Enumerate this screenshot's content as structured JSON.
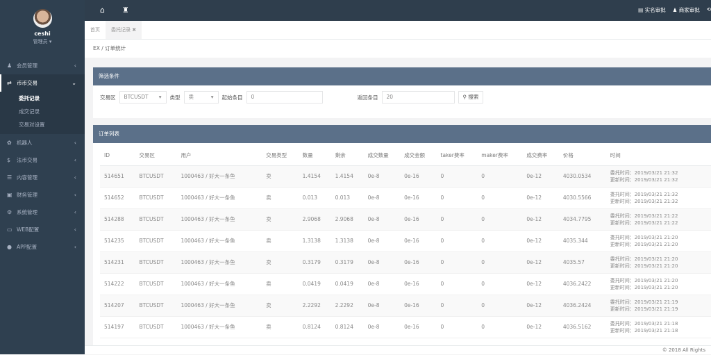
{
  "user": {
    "name": "ceshi",
    "role": "管理员 ▾"
  },
  "sidebar": {
    "items": [
      {
        "icon": "user-icon",
        "glyph": "♟",
        "label": "会员管理"
      },
      {
        "icon": "exchange-icon",
        "glyph": "⇄",
        "label": "币币交易",
        "expanded": true,
        "children": [
          {
            "label": "委托记录",
            "active": true
          },
          {
            "label": "成交记录"
          },
          {
            "label": "交易对设置"
          }
        ]
      },
      {
        "icon": "robot-icon",
        "glyph": "✿",
        "label": "机器人"
      },
      {
        "icon": "dollar-icon",
        "glyph": "$",
        "label": "法币交易"
      },
      {
        "icon": "list-icon",
        "glyph": "☰",
        "label": "内容管理"
      },
      {
        "icon": "money-icon",
        "glyph": "▣",
        "label": "财务管理"
      },
      {
        "icon": "gears-icon",
        "glyph": "⚙",
        "label": "系统管理"
      },
      {
        "icon": "laptop-icon",
        "glyph": "▭",
        "label": "WEB配置"
      },
      {
        "icon": "app-icon",
        "glyph": "●",
        "label": "APP配置"
      }
    ]
  },
  "topbar": {
    "right": [
      {
        "icon": "id-card-icon",
        "glyph": "▤",
        "label": "实名审批"
      },
      {
        "icon": "user-icon",
        "glyph": "♟",
        "label": "商家审批"
      },
      {
        "icon": "refresh-icon",
        "glyph": "⟲",
        "label": ""
      }
    ]
  },
  "tabs": [
    {
      "label": "首页"
    },
    {
      "label": "委托记录 ✖",
      "active": true
    }
  ],
  "breadcrumb": "EX / 订单统计",
  "filter": {
    "title": "筛选条件",
    "market_label": "交易区",
    "market": "BTCUSDT",
    "type_label": "类型",
    "type": "卖",
    "start_label": "起始条目",
    "start": "0",
    "count_label": "返回条目",
    "count": "20",
    "search": "搜索"
  },
  "table": {
    "title": "订单列表",
    "headers": [
      "ID",
      "交易区",
      "用户",
      "交易类型",
      "数量",
      "剩余",
      "成交数量",
      "成交金额",
      "taker费率",
      "maker费率",
      "成交费率",
      "价格",
      "时间"
    ],
    "rows": [
      [
        "514651",
        "BTCUSDT",
        "1000463 / 好大一条鱼",
        "卖",
        "1.4154",
        "1.4154",
        "0e-8",
        "0e-16",
        "0",
        "0",
        "0e-12",
        "4030.0534",
        "委托时间：2019/03/21 21:32",
        "更新时间：2019/03/21 21:32"
      ],
      [
        "514652",
        "BTCUSDT",
        "1000463 / 好大一条鱼",
        "卖",
        "0.013",
        "0.013",
        "0e-8",
        "0e-16",
        "0",
        "0",
        "0e-12",
        "4030.5566",
        "委托时间：2019/03/21 21:32",
        "更新时间：2019/03/21 21:32"
      ],
      [
        "514288",
        "BTCUSDT",
        "1000463 / 好大一条鱼",
        "卖",
        "2.9068",
        "2.9068",
        "0e-8",
        "0e-16",
        "0",
        "0",
        "0e-12",
        "4034.7795",
        "委托时间：2019/03/21 21:22",
        "更新时间：2019/03/21 21:22"
      ],
      [
        "514235",
        "BTCUSDT",
        "1000463 / 好大一条鱼",
        "卖",
        "1.3138",
        "1.3138",
        "0e-8",
        "0e-16",
        "0",
        "0",
        "0e-12",
        "4035.344",
        "委托时间：2019/03/21 21:20",
        "更新时间：2019/03/21 21:20"
      ],
      [
        "514231",
        "BTCUSDT",
        "1000463 / 好大一条鱼",
        "卖",
        "0.3179",
        "0.3179",
        "0e-8",
        "0e-16",
        "0",
        "0",
        "0e-12",
        "4035.57",
        "委托时间：2019/03/21 21:20",
        "更新时间：2019/03/21 21:20"
      ],
      [
        "514222",
        "BTCUSDT",
        "1000463 / 好大一条鱼",
        "卖",
        "0.0419",
        "0.0419",
        "0e-8",
        "0e-16",
        "0",
        "0",
        "0e-12",
        "4036.2422",
        "委托时间：2019/03/21 21:20",
        "更新时间：2019/03/21 21:20"
      ],
      [
        "514207",
        "BTCUSDT",
        "1000463 / 好大一条鱼",
        "卖",
        "2.2292",
        "2.2292",
        "0e-8",
        "0e-16",
        "0",
        "0",
        "0e-12",
        "4036.2424",
        "委托时间：2019/03/21 21:19",
        "更新时间：2019/03/21 21:19"
      ],
      [
        "514197",
        "BTCUSDT",
        "1000463 / 好大一条鱼",
        "卖",
        "0.8124",
        "0.8124",
        "0e-8",
        "0e-16",
        "0",
        "0",
        "0e-12",
        "4036.5162",
        "委托时间：2019/03/21 21:18",
        "更新时间：2019/03/21 21:18"
      ]
    ]
  },
  "footer": "© 2018 All Rights"
}
